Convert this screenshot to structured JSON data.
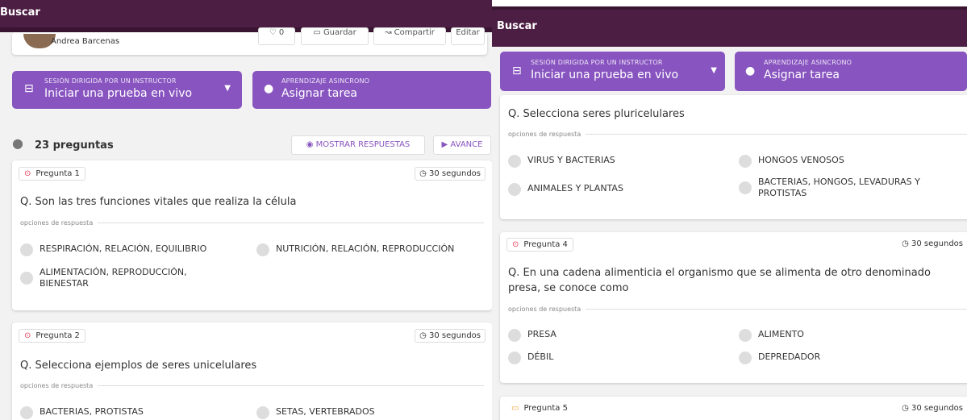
{
  "left": {
    "topbar": {
      "title": "Buscar"
    },
    "author": {
      "name": "Andrea Barcenas",
      "likes": "0",
      "save": "Guardar",
      "share": "Compartir",
      "edit": "Editar"
    },
    "live_button": {
      "small": "SESIÓN DIRIGIDA POR UN INSTRUCTOR",
      "label": "Iniciar una prueba en vivo"
    },
    "async_button": {
      "small": "APRENDIZAJE ASINCRONO",
      "label": "Asignar tarea"
    },
    "count": "23 preguntas",
    "show_answers": "MOSTRAR RESPUESTAS",
    "advance": "AVANCE",
    "questions": [
      {
        "badge": "Pregunta 1",
        "timer": "30 segundos",
        "text": "Q. Son las tres funciones vitales que realiza la célula",
        "options_label": "opciones de respuesta",
        "options": [
          "RESPIRACIÓN, RELACIÓN, EQUILIBRIO",
          "NUTRICIÓN, RELACIÓN, REPRODUCCIÓN",
          "ALIMENTACIÓN, REPRODUCCIÓN, BIENESTAR"
        ]
      },
      {
        "badge": "Pregunta 2",
        "timer": "30 segundos",
        "text": "Q. Selecciona ejemplos de seres unicelulares",
        "options_label": "opciones de respuesta",
        "options": [
          "BACTERIAS, PROTISTAS",
          "SETAS, VERTEBRADOS"
        ]
      }
    ]
  },
  "right": {
    "topbar": {
      "title": "Buscar"
    },
    "live_button": {
      "small": "SESIÓN DIRIGIDA POR UN INSTRUCTOR",
      "label": "Iniciar una prueba en vivo"
    },
    "async_button": {
      "small": "APRENDIZAJE ASINCRONO",
      "label": "Asignar tarea"
    },
    "q3": {
      "text": "Q. Selecciona seres pluricelulares",
      "options_label": "opciones de respuesta",
      "options": [
        "VIRUS Y BACTERIAS",
        "HONGOS VENOSOS",
        "ANIMALES Y PLANTAS",
        "BACTERIAS, HONGOS, LEVADURAS Y PROTISTAS"
      ]
    },
    "q4": {
      "badge": "Pregunta 4",
      "timer": "30 segundos",
      "text": "Q. En una cadena alimenticia el organismo que se alimenta de otro denominado presa, se conoce como",
      "options_label": "opciones de respuesta",
      "options": [
        "PRESA",
        "ALIMENTO",
        "DÉBIL",
        "DEPREDADOR"
      ]
    },
    "q5": {
      "badge": "Pregunta 5",
      "timer": "30 segundos"
    }
  },
  "colors": {
    "topbar": "#4d1e43",
    "accent": "#8854c0",
    "badge_icon": "#e53950",
    "q5_icon": "#f0a030"
  }
}
